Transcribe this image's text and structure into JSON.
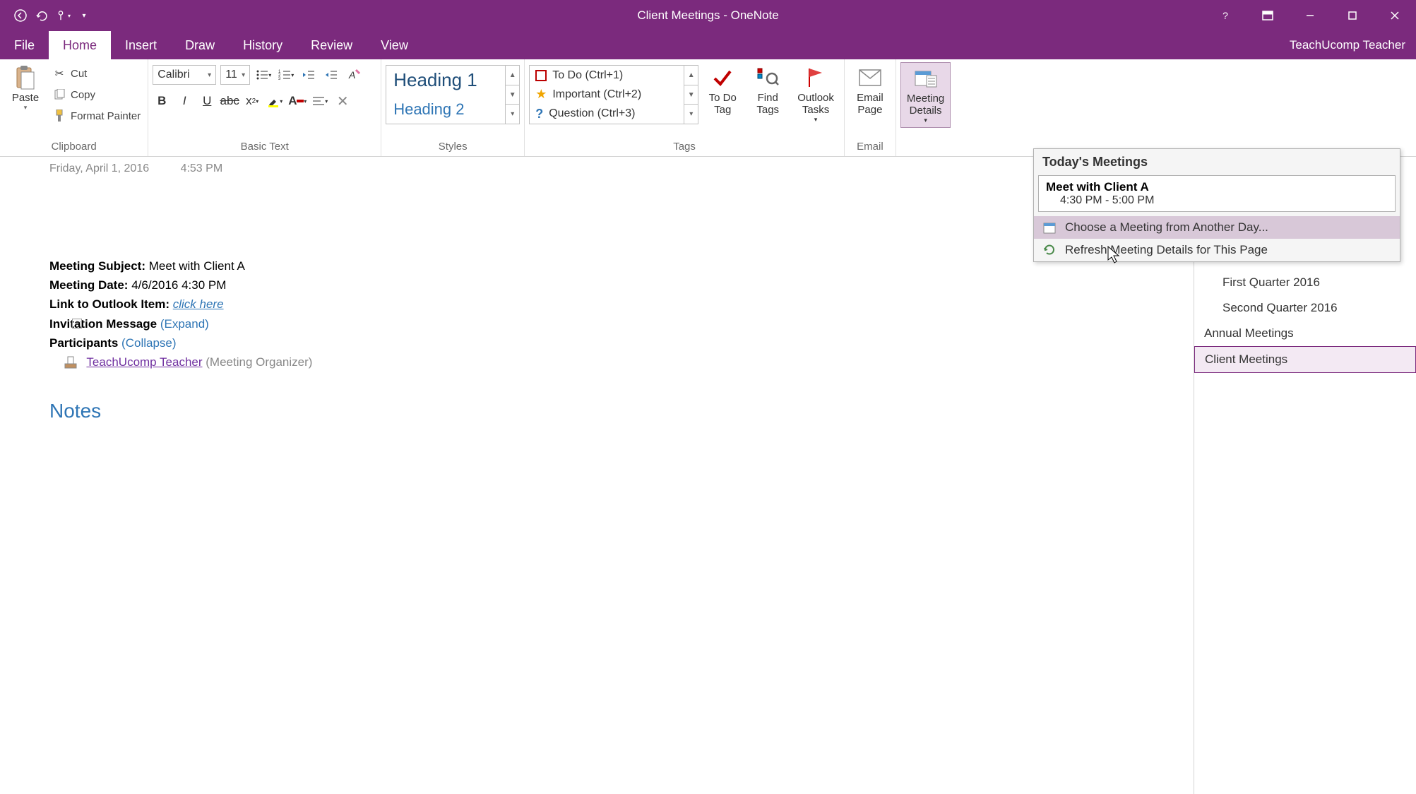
{
  "titlebar": {
    "title": "Client Meetings - OneNote"
  },
  "menubar": {
    "tabs": [
      "File",
      "Home",
      "Insert",
      "Draw",
      "History",
      "Review",
      "View"
    ],
    "active": "Home",
    "user": "TeachUcomp Teacher"
  },
  "ribbon": {
    "clipboard": {
      "paste": "Paste",
      "cut": "Cut",
      "copy": "Copy",
      "format_painter": "Format Painter",
      "label": "Clipboard"
    },
    "basic_text": {
      "font": "Calibri",
      "size": "11",
      "label": "Basic Text"
    },
    "styles": {
      "h1": "Heading 1",
      "h2": "Heading 2",
      "label": "Styles"
    },
    "tags": {
      "items": [
        {
          "label": "To Do (Ctrl+1)"
        },
        {
          "label": "Important (Ctrl+2)"
        },
        {
          "label": "Question (Ctrl+3)"
        }
      ],
      "todo_tag": "To Do\nTag",
      "find_tags": "Find\nTags",
      "outlook_tasks": "Outlook\nTasks",
      "label": "Tags"
    },
    "email": {
      "email_page": "Email\nPage",
      "label": "Email"
    },
    "meetings": {
      "meeting_details": "Meeting\nDetails"
    }
  },
  "dropdown": {
    "header": "Today's Meetings",
    "meeting_title": "Meet with Client A",
    "meeting_time": "4:30 PM - 5:00 PM",
    "choose": "Choose a Meeting from Another Day...",
    "refresh": "Refresh Meeting Details for This Page"
  },
  "page": {
    "date": "Friday, April 1, 2016",
    "time": "4:53 PM",
    "subject_label": "Meeting Subject:",
    "subject_value": "Meet with Client A",
    "date_label": "Meeting Date:",
    "date_value": "4/6/2016 4:30 PM",
    "link_label": "Link to Outlook Item:",
    "link_text": "click here",
    "invitation_label": "Invitation Message",
    "expand": "(Expand)",
    "participants_label": "Participants",
    "collapse": "(Collapse)",
    "participant_name": "TeachUcomp Teacher",
    "participant_role": "(Meeting Organizer)",
    "notes": "Notes"
  },
  "sidebar": {
    "items": [
      {
        "label": "First Quarter 2016",
        "indent": true
      },
      {
        "label": "Second Quarter 2016",
        "indent": true
      },
      {
        "label": "Annual Meetings",
        "indent": false
      },
      {
        "label": "Client Meetings",
        "indent": false,
        "selected": true
      }
    ]
  }
}
